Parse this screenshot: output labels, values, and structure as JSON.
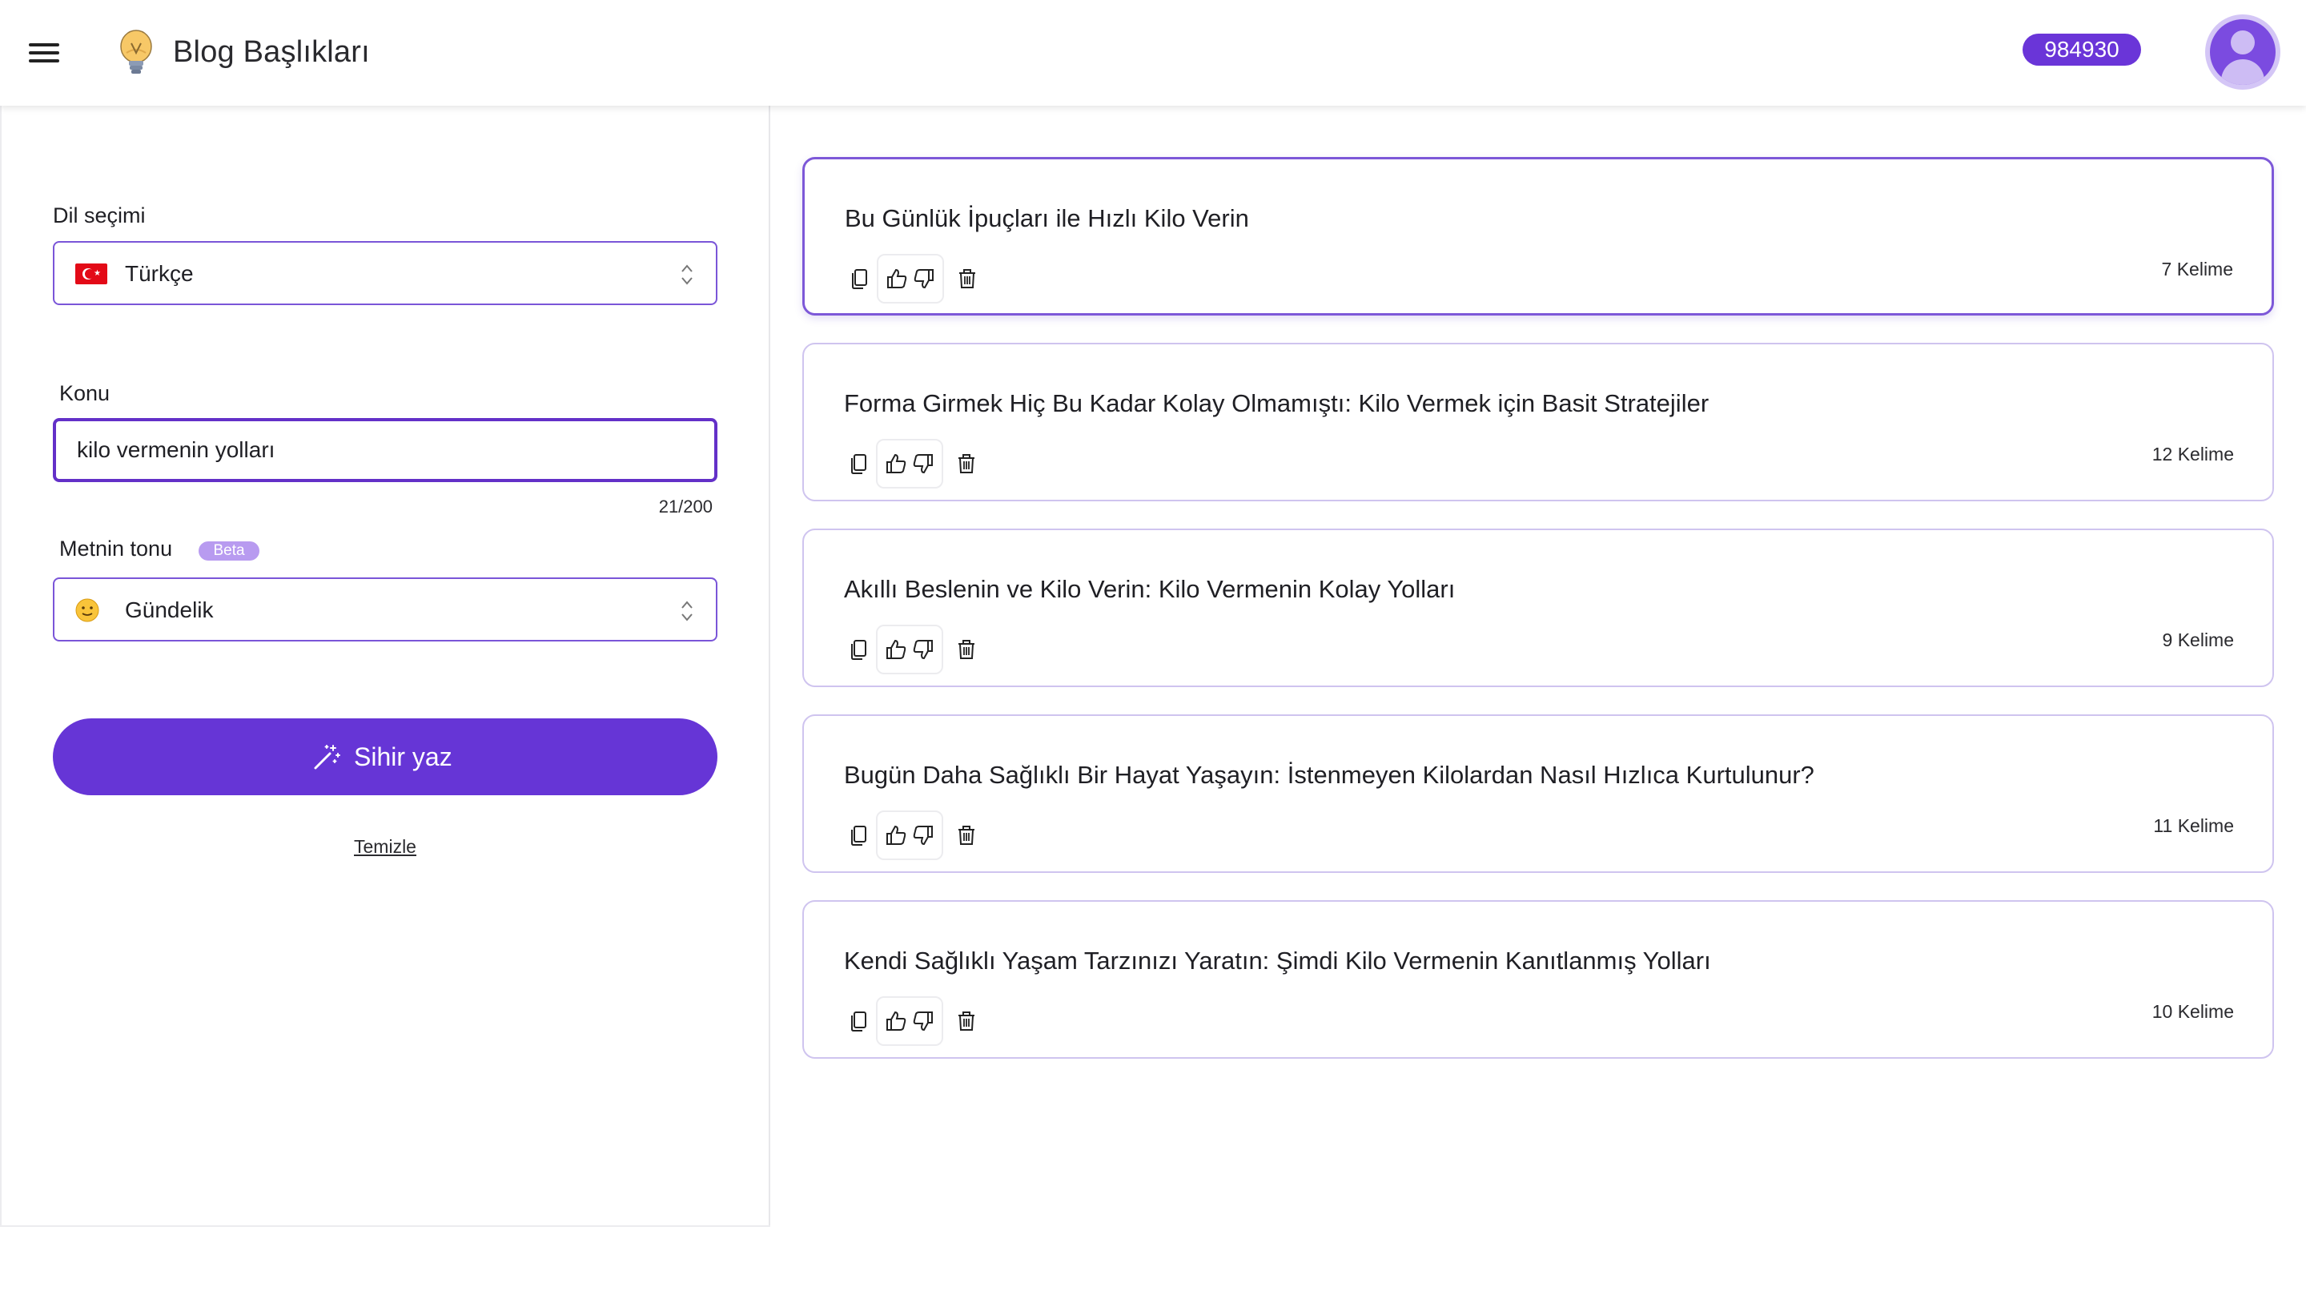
{
  "header": {
    "title": "Blog Başlıkları",
    "credits": "984930"
  },
  "form": {
    "language_label": "Dil seçimi",
    "language_value": "Türkçe",
    "topic_label": "Konu",
    "topic_value": "kilo vermenin yolları",
    "char_count": "21/200",
    "tone_label": "Metnin tonu",
    "tone_badge": "Beta",
    "tone_value": "Gündelik",
    "generate_label": "Sihir yaz",
    "clear_label": "Temizle"
  },
  "results": [
    {
      "title": "Bu Günlük İpuçları ile Hızlı Kilo Verin",
      "words": "7 Kelime"
    },
    {
      "title": "Forma Girmek Hiç Bu Kadar Kolay Olmamıştı: Kilo Vermek için Basit Stratejiler",
      "words": "12 Kelime"
    },
    {
      "title": "Akıllı Beslenin ve Kilo Verin: Kilo Vermenin Kolay Yolları",
      "words": "9 Kelime"
    },
    {
      "title": "Bugün Daha Sağlıklı Bir Hayat Yaşayın: İstenmeyen Kilolardan Nasıl Hızlıca Kurtulunur?",
      "words": "11 Kelime"
    },
    {
      "title": "Kendi Sağlıklı Yaşam Tarzınızı Yaratın: Şimdi Kilo Vermenin Kanıtlanmış Yolları",
      "words": "10 Kelime"
    }
  ],
  "colors": {
    "accent": "#6635d6",
    "badge": "#6a35d8",
    "card_border": "#cfc4ef"
  }
}
